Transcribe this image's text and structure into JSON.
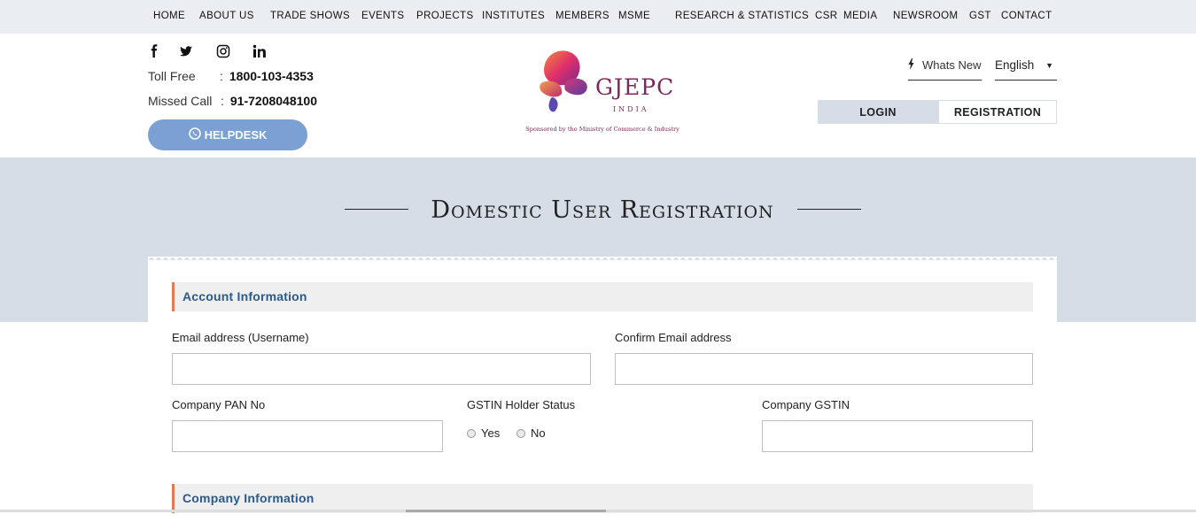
{
  "nav": {
    "items": [
      {
        "label": "HOME"
      },
      {
        "label": "ABOUT US"
      },
      {
        "label": "TRADE SHOWS"
      },
      {
        "label": "EVENTS"
      },
      {
        "label": "PROJECTS"
      },
      {
        "label": "INSTITUTES"
      },
      {
        "label": "MEMBERS"
      },
      {
        "label": "MSME"
      },
      {
        "label": "RESEARCH & STATISTICS"
      },
      {
        "label": "CSR"
      },
      {
        "label": "MEDIA"
      },
      {
        "label": "NEWSROOM"
      },
      {
        "label": "GST"
      },
      {
        "label": "CONTACT"
      }
    ]
  },
  "header": {
    "social_icons": [
      "facebook-icon",
      "twitter-icon",
      "instagram-icon",
      "linkedin-icon"
    ],
    "toll_free_label": "Toll Free",
    "toll_free_sep": ":",
    "toll_free_number": "1800-103-4353",
    "missed_call_label": "Missed Call",
    "missed_call_sep": ":",
    "missed_call_number": "91-7208048100",
    "helpdesk_label": "HELPDESK",
    "logo_brand": "GJEPC",
    "logo_sub": "INDIA",
    "logo_tagline": "Sponsored by the Ministry of Commerce & Industry",
    "whats_new": "Whats New",
    "language": "English",
    "login_label": "LOGIN",
    "registration_label": "REGISTRATION"
  },
  "banner": {
    "title": "Domestic User Registration"
  },
  "form": {
    "account_section": "Account Information",
    "email_label": "Email address (Username)",
    "email_value": "",
    "confirm_email_label": "Confirm Email address",
    "confirm_email_value": "",
    "pan_label": "Company PAN No",
    "pan_value": "",
    "gstin_status_label": "GSTIN Holder Status",
    "gstin_yes": "Yes",
    "gstin_no": "No",
    "gstin_label": "Company GSTIN",
    "gstin_value": "",
    "company_section": "Company Information"
  },
  "colors": {
    "nav_bg": "#eaedf1",
    "banner_bg": "#d6dde7",
    "helpdesk_bg": "#7aa0d4",
    "section_accent": "#e07b4f",
    "section_text": "#2a5a8c",
    "logo_text": "#7a2a5a"
  }
}
